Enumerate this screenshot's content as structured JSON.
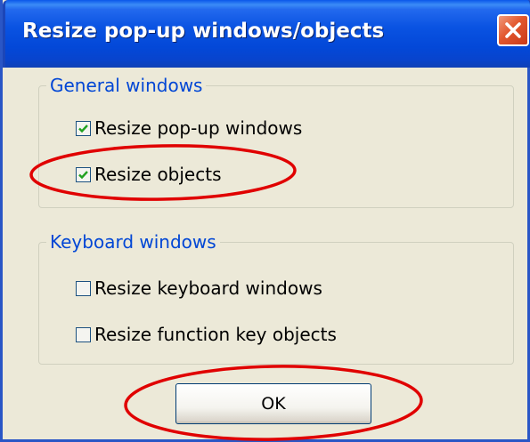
{
  "window": {
    "title": "Resize pop-up windows/objects",
    "close_icon": "close-icon"
  },
  "general_group": {
    "legend": "General windows",
    "options": [
      {
        "label": "Resize pop-up windows",
        "checked": true
      },
      {
        "label": "Resize objects",
        "checked": true
      }
    ]
  },
  "keyboard_group": {
    "legend": "Keyboard windows",
    "options": [
      {
        "label": "Resize keyboard windows",
        "checked": false
      },
      {
        "label": "Resize function key objects",
        "checked": false
      }
    ]
  },
  "ok_button": {
    "label": "OK"
  },
  "colors": {
    "titlebar": "#0a53e2",
    "group_legend": "#0046d5",
    "checkmark": "#21a121",
    "annotation": "#e00000",
    "face": "#ece9d8"
  }
}
